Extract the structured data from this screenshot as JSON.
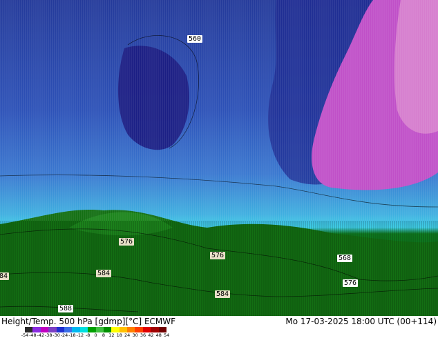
{
  "map": {
    "contour_labels": [
      {
        "text": "560",
        "bg": "#ffffff"
      },
      {
        "text": "576",
        "bg": "#e8e0c8"
      },
      {
        "text": "576",
        "bg": "#e8e0c8"
      },
      {
        "text": "568",
        "bg": "#ffffff"
      },
      {
        "text": "576",
        "bg": "#ffffff"
      },
      {
        "text": "84",
        "bg": "#e8e0c8"
      },
      {
        "text": "584",
        "bg": "#e8e0c8"
      },
      {
        "text": "584",
        "bg": "#e8e0c8"
      },
      {
        "text": "588",
        "bg": "#ffffff"
      }
    ]
  },
  "footer": {
    "title": "Height/Temp. 500 hPa [gdmp][°C] ECMWF",
    "datetime": "Mo 17-03-2025 18:00 UTC (00+114)"
  },
  "legend": {
    "ticks": [
      "-54",
      "-48",
      "-42",
      "-38",
      "-30",
      "-24",
      "-18",
      "-12",
      "-8",
      "0",
      "8",
      "12",
      "18",
      "24",
      "30",
      "36",
      "42",
      "48",
      "54"
    ],
    "colors": [
      "#2a2a2a",
      "#8a2be2",
      "#c000c0",
      "#7b3fc4",
      "#2030d0",
      "#3a6ee8",
      "#00b8f0",
      "#00e0e0",
      "#00a000",
      "#40c040",
      "#009000",
      "#ffff00",
      "#ffc000",
      "#ff8000",
      "#ff4000",
      "#e00000",
      "#a00000",
      "#700000"
    ]
  },
  "colors": {
    "deep_blue": "#1a1a80",
    "mid_blue": "#2f4fb0",
    "light_blue": "#3f88d8",
    "cyan": "#3fc8e8",
    "green_dark": "#0a6e0a",
    "green": "#1f8a1f",
    "magenta": "#c050c8",
    "pink": "#e090d0"
  }
}
